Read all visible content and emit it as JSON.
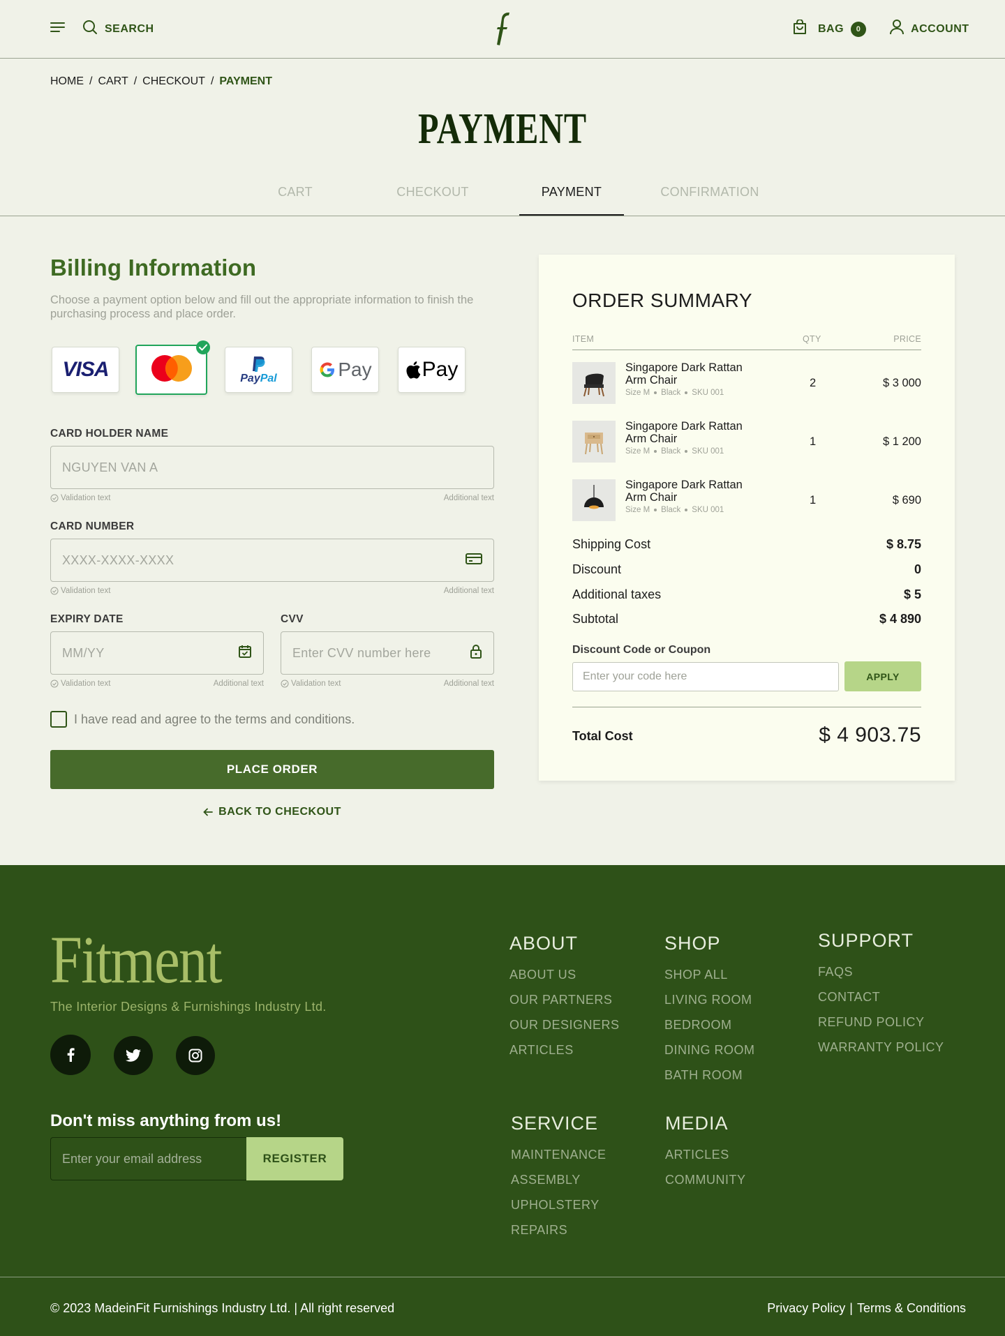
{
  "header": {
    "search_label": "SEARCH",
    "logo_letter": "F",
    "bag_label": "BAG",
    "bag_count": "0",
    "account_label": "ACCOUNT"
  },
  "breadcrumb": {
    "items": [
      "HOME",
      "CART",
      "CHECKOUT"
    ],
    "separator": "/",
    "current": "PAYMENT"
  },
  "page_title": "PAYMENT",
  "steps": [
    "CART",
    "CHECKOUT",
    "PAYMENT",
    "CONFIRMATION"
  ],
  "billing": {
    "title": "Billing Information",
    "description": "Choose a payment option below and fill out the appropriate information to finish the purchasing process and place order.",
    "payment_methods": [
      {
        "name": "VISA",
        "icon": "visa-logo",
        "selected": false
      },
      {
        "name": "Mastercard",
        "icon": "mastercard-logo",
        "selected": true
      },
      {
        "name": "PayPal",
        "icon": "paypal-logo",
        "selected": false
      },
      {
        "name": "G Pay",
        "icon": "google-pay-logo",
        "selected": false
      },
      {
        "name": "Pay",
        "icon": "apple-pay-logo",
        "selected": false
      }
    ],
    "card_holder": {
      "label": "CARD HOLDER NAME",
      "placeholder": "NGUYEN VAN A",
      "validation": "Validation text",
      "additional": "Additional text"
    },
    "card_number": {
      "label": "CARD NUMBER",
      "placeholder": "XXXX-XXXX-XXXX",
      "validation": "Validation text",
      "additional": "Additional text"
    },
    "expiry": {
      "label": "EXPIRY DATE",
      "placeholder": "MM/YY",
      "validation": "Validation text",
      "additional": "Additional text"
    },
    "cvv": {
      "label": "CVV",
      "placeholder": "Enter CVV number here",
      "validation": "Validation text",
      "additional": "Additional text"
    },
    "terms": "I have read and agree to the terms and conditions.",
    "place_order": "PLACE ORDER",
    "back": "BACK TO CHECKOUT"
  },
  "summary": {
    "title": "ORDER SUMMARY",
    "columns": {
      "item": "ITEM",
      "qty": "QTY",
      "price": "PRICE"
    },
    "items": [
      {
        "name": "Singapore Dark Rattan Arm Chair",
        "size": "Size M",
        "color": "Black",
        "sku": "SKU 001",
        "qty": "2",
        "price": "$ 3 000"
      },
      {
        "name": "Singapore Dark Rattan Arm Chair",
        "size": "Size M",
        "color": "Black",
        "sku": "SKU 001",
        "qty": "1",
        "price": "$ 1 200"
      },
      {
        "name": "Singapore Dark Rattan Arm Chair",
        "size": "Size M",
        "color": "Black",
        "sku": "SKU 001",
        "qty": "1",
        "price": "$ 690"
      }
    ],
    "costs": [
      {
        "label": "Shipping Cost",
        "value": "$ 8.75"
      },
      {
        "label": "Discount",
        "value": "0"
      },
      {
        "label": "Additional taxes",
        "value": "$ 5"
      },
      {
        "label": "Subtotal",
        "value": "$ 4 890"
      }
    ],
    "coupon_label": "Discount Code or Coupon",
    "coupon_placeholder": "Enter your code here",
    "apply": "APPLY",
    "total_label": "Total Cost",
    "total_value": "$ 4 903.75"
  },
  "footer": {
    "brand": "Fitment",
    "tagline": "The Interior Designs & Furnishings Industry Ltd.",
    "newsletter_title": "Don't miss anything from us!",
    "email_placeholder": "Enter your email address",
    "register": "REGISTER",
    "columns": {
      "about": {
        "title": "ABOUT",
        "links": [
          "ABOUT US",
          "OUR PARTNERS",
          "OUR DESIGNERS",
          "ARTICLES"
        ]
      },
      "shop": {
        "title": "SHOP",
        "links": [
          "SHOP ALL",
          "LIVING ROOM",
          "BEDROOM",
          "DINING ROOM",
          "BATH ROOM"
        ]
      },
      "support": {
        "title": "SUPPORT",
        "links": [
          "FAQS",
          "CONTACT",
          "REFUND POLICY",
          "WARRANTY POLICY"
        ]
      },
      "service": {
        "title": "SERVICE",
        "links": [
          "MAINTENANCE",
          "ASSEMBLY",
          "UPHOLSTERY",
          "REPAIRS"
        ]
      },
      "media": {
        "title": "MEDIA",
        "links": [
          "ARTICLES",
          "COMMUNITY"
        ]
      }
    },
    "copyright": "© 2023 MadeinFit Furnishings Industry Ltd.  | All right reserved",
    "privacy": "Privacy Policy",
    "legal_sep": "|",
    "terms": "Terms & Conditions"
  },
  "colors": {
    "brand_dark": "#2f5417",
    "accent_light": "#b6d588",
    "success": "#21a55b",
    "footer_bg": "#2e5118"
  }
}
